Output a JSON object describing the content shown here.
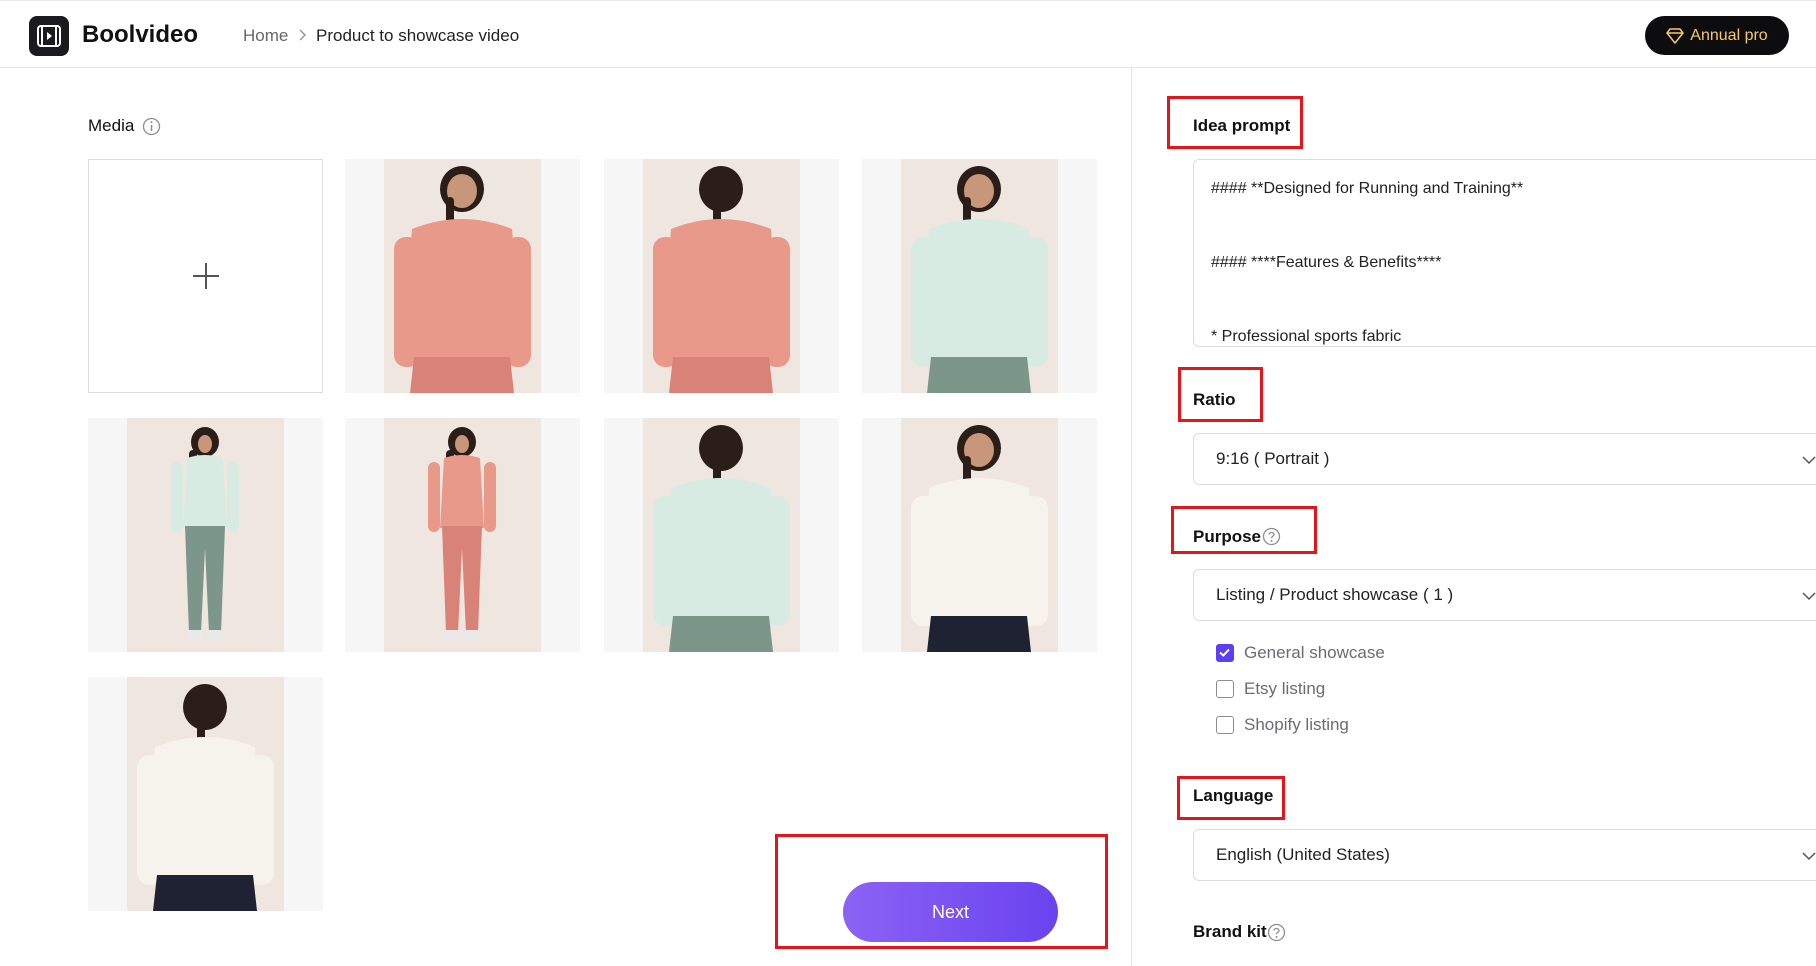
{
  "header": {
    "app_name": "Boolvideo",
    "breadcrumb": {
      "home": "Home",
      "current": "Product to showcase video"
    },
    "pro_button": "Annual pro",
    "pro_icon": "diamond-icon"
  },
  "media": {
    "label": "Media",
    "info_icon": "info-icon",
    "upload_icon": "plus-icon",
    "images": [
      {
        "name": "product-image-1",
        "shirt_color": "#e8998a",
        "pants_color": "#d98378",
        "view": "front"
      },
      {
        "name": "product-image-2",
        "shirt_color": "#e8998a",
        "pants_color": "#d98378",
        "view": "back"
      },
      {
        "name": "product-image-3",
        "shirt_color": "#d8ebe2",
        "pants_color": "#7d968a",
        "view": "front"
      },
      {
        "name": "product-image-4",
        "shirt_color": "#d8ebe2",
        "pants_color": "#7d968a",
        "view": "full"
      },
      {
        "name": "product-image-5",
        "shirt_color": "#e8998a",
        "pants_color": "#d98378",
        "view": "full"
      },
      {
        "name": "product-image-6",
        "shirt_color": "#d8ebe2",
        "pants_color": "#7d968a",
        "view": "back"
      },
      {
        "name": "product-image-7",
        "shirt_color": "#f6f3ec",
        "pants_color": "#1f2233",
        "view": "front"
      },
      {
        "name": "product-image-8",
        "shirt_color": "#f6f3ec",
        "pants_color": "#1f2233",
        "view": "back"
      }
    ]
  },
  "next_button": "Next",
  "idea_prompt": {
    "label": "Idea prompt",
    "lines": [
      "#### **Designed for Running and Training**",
      "#### ****Features & Benefits****",
      "* Professional sports fabric"
    ]
  },
  "ratio": {
    "label": "Ratio",
    "value": "9:16 ( Portrait )"
  },
  "purpose": {
    "label": "Purpose",
    "value": "Listing / Product showcase ( 1 )",
    "options": [
      {
        "label": "General showcase",
        "checked": true
      },
      {
        "label": "Etsy listing",
        "checked": false
      },
      {
        "label": "Shopify listing",
        "checked": false
      }
    ]
  },
  "language": {
    "label": "Language",
    "value": "English (United States)"
  },
  "brand_kit": {
    "label": "Brand kit"
  },
  "colors": {
    "accent": "#5b3ff0",
    "annotation": "#e4161c",
    "pro_text": "#f6c86a"
  }
}
